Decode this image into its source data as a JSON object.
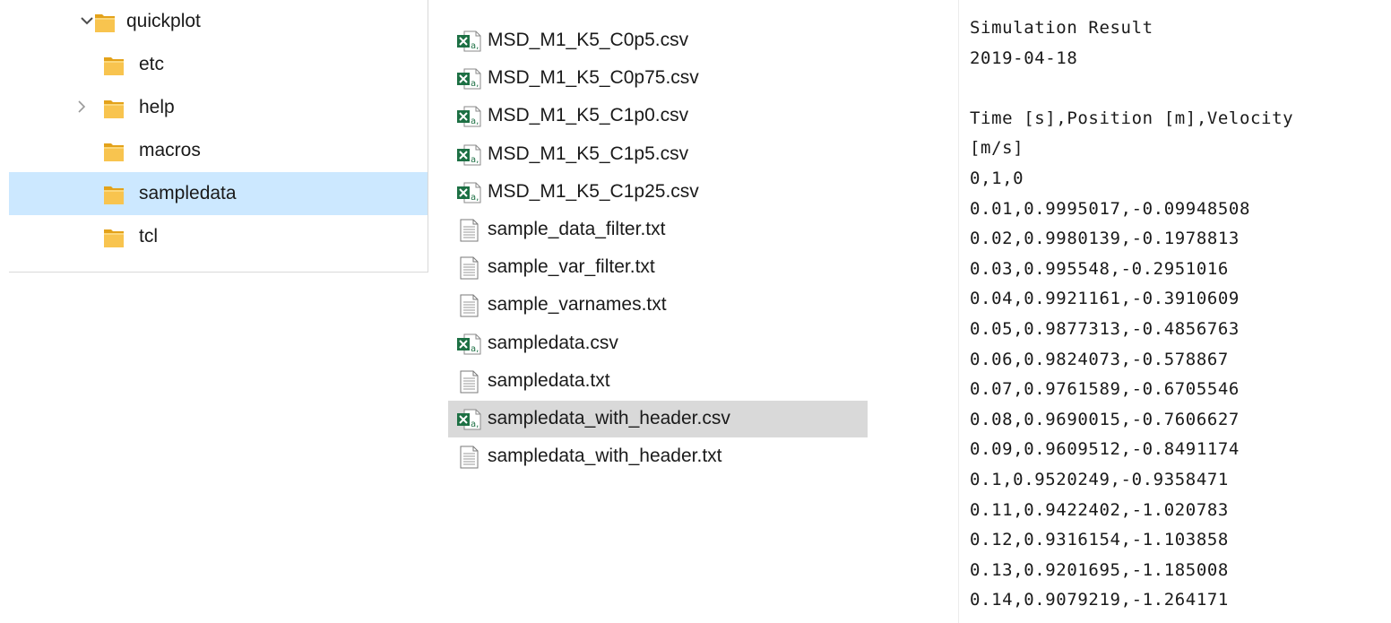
{
  "tree": {
    "items": [
      {
        "label": "quickplot",
        "chevron": "expanded",
        "indent": 0,
        "selected": false
      },
      {
        "label": "etc",
        "chevron": "none",
        "indent": 1,
        "selected": false
      },
      {
        "label": "help",
        "chevron": "collapsed",
        "indent": 1,
        "selected": false
      },
      {
        "label": "macros",
        "chevron": "none",
        "indent": 1,
        "selected": false
      },
      {
        "label": "sampledata",
        "chevron": "none",
        "indent": 1,
        "selected": true
      },
      {
        "label": "tcl",
        "chevron": "none",
        "indent": 1,
        "selected": false
      }
    ]
  },
  "files": {
    "items": [
      {
        "name": "MSD_M1_K5_C0p5.csv",
        "icon": "excel-csv-icon"
      },
      {
        "name": "MSD_M1_K5_C0p75.csv",
        "icon": "excel-csv-icon"
      },
      {
        "name": "MSD_M1_K5_C1p0.csv",
        "icon": "excel-csv-icon"
      },
      {
        "name": "MSD_M1_K5_C1p5.csv",
        "icon": "excel-csv-icon"
      },
      {
        "name": "MSD_M1_K5_C1p25.csv",
        "icon": "excel-csv-icon"
      },
      {
        "name": "sample_data_filter.txt",
        "icon": "text-file-icon"
      },
      {
        "name": "sample_var_filter.txt",
        "icon": "text-file-icon"
      },
      {
        "name": "sample_varnames.txt",
        "icon": "text-file-icon"
      },
      {
        "name": "sampledata.csv",
        "icon": "excel-csv-icon"
      },
      {
        "name": "sampledata.txt",
        "icon": "text-file-icon"
      },
      {
        "name": "sampledata_with_header.csv",
        "icon": "excel-csv-icon",
        "hovered": true
      },
      {
        "name": "sampledata_with_header.txt",
        "icon": "text-file-icon"
      }
    ]
  },
  "preview": {
    "lines": [
      "Simulation Result",
      "2019-04-18",
      "",
      "Time [s],Position [m],Velocity",
      "[m/s]",
      "0,1,0",
      "0.01,0.9995017,-0.09948508",
      "0.02,0.9980139,-0.1978813",
      "0.03,0.995548,-0.2951016",
      "0.04,0.9921161,-0.3910609",
      "0.05,0.9877313,-0.4856763",
      "0.06,0.9824073,-0.578867",
      "0.07,0.9761589,-0.6705546",
      "0.08,0.9690015,-0.7606627",
      "0.09,0.9609512,-0.8491174",
      "0.1,0.9520249,-0.9358471",
      "0.11,0.9422402,-1.020783",
      "0.12,0.9316154,-1.103858",
      "0.13,0.9201695,-1.185008",
      "0.14,0.9079219,-1.264171"
    ]
  },
  "colors": {
    "selection": "#cce8ff",
    "hover": "#d9d9d9",
    "folder": "#f8c44f",
    "excel": "#1d7044"
  }
}
